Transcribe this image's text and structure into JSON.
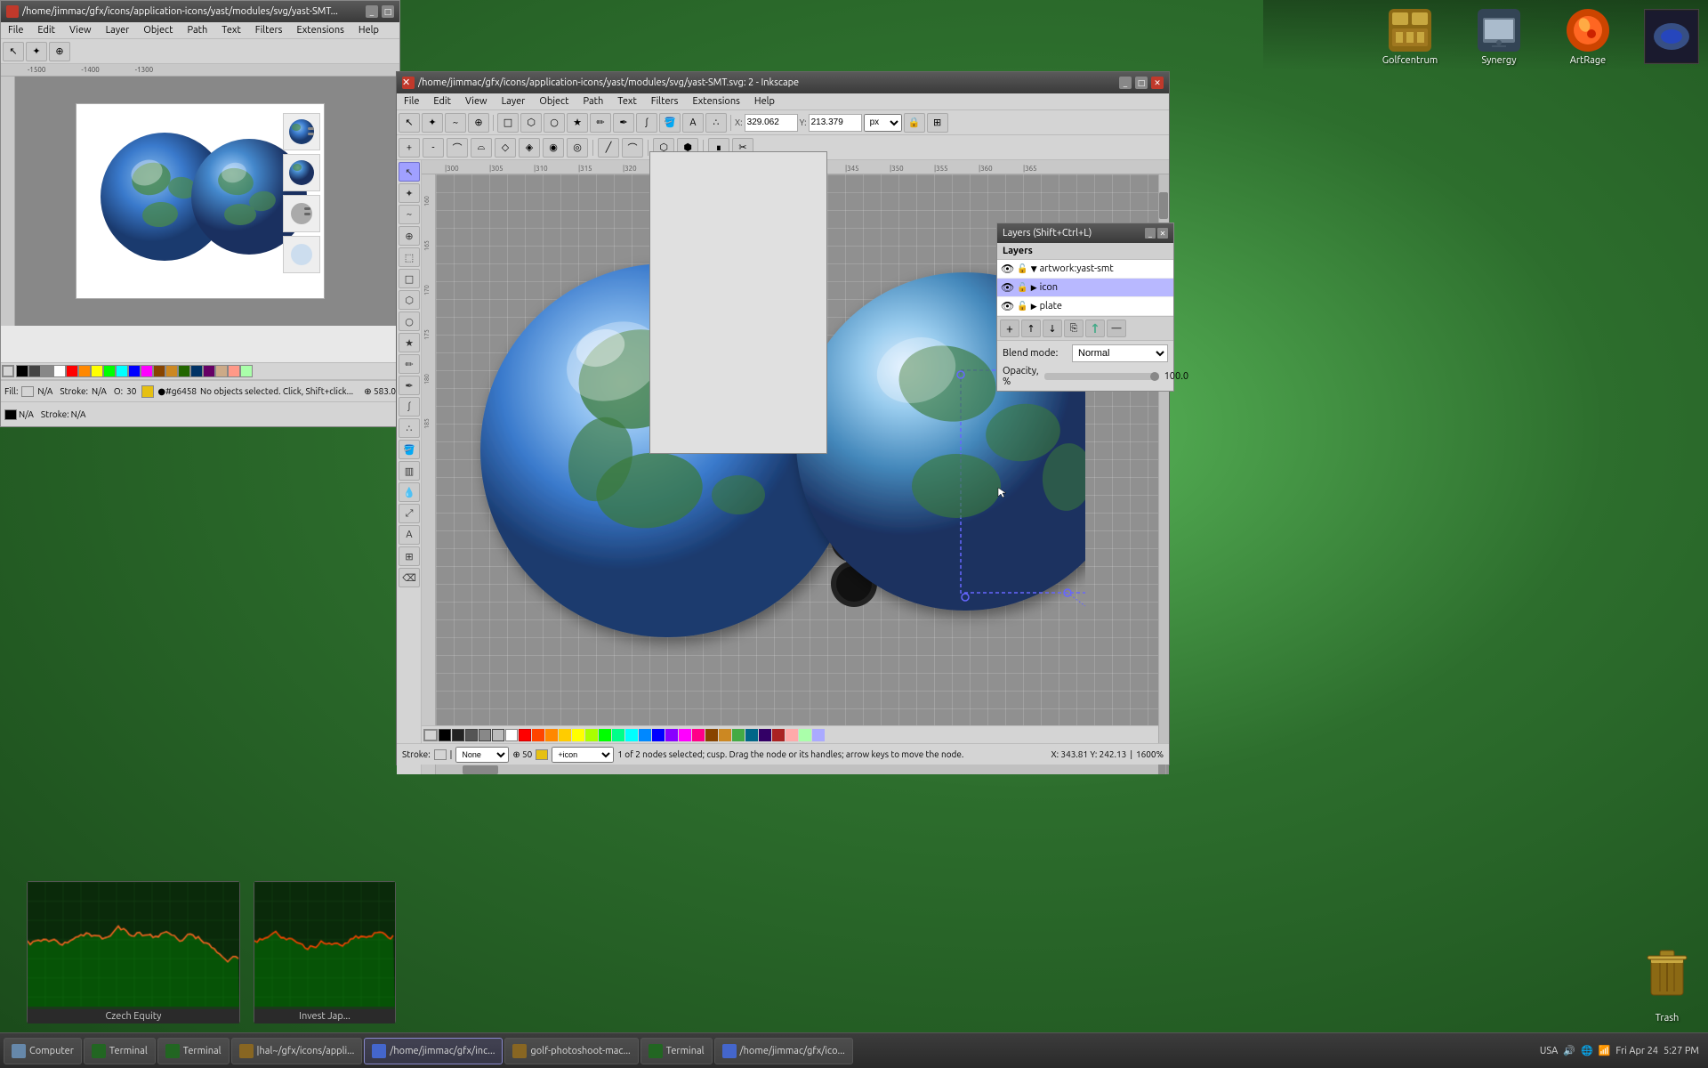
{
  "desktop": {
    "background": "green gradient"
  },
  "inkscape_small": {
    "title": "/home/jimmac/gfx/icons/application-icons/yast/modules/svg/yast-SMT...",
    "menu": [
      "File",
      "Edit",
      "View",
      "Layer",
      "Object",
      "Path",
      "Text",
      "Filters",
      "Extensions",
      "Help"
    ]
  },
  "inkscape_main": {
    "title": "/home/jimmac/gfx/icons/application-icons/yast/modules/svg/yast-SMT.svg: 2 - Inkscape",
    "menu": [
      "File",
      "Edit",
      "View",
      "Layer",
      "Object",
      "Path",
      "Text",
      "Filters",
      "Extensions",
      "Help"
    ],
    "coords": {
      "x_label": "X:",
      "x_value": "329.062",
      "y_label": "Y:",
      "y_value": "213.379",
      "unit": "px"
    },
    "statusbar": {
      "fill_label": "Fill:",
      "fill_value": "N/A",
      "stroke_label": "Stroke:",
      "stroke_value": "N/A",
      "opacity_label": "O:",
      "opacity_value": "30",
      "color_hex": "#g6458",
      "status_text": "No objects selected. Click, Shift+click...",
      "node_status": "1 of 2 nodes selected; cusp. Drag the node or its handles; arrow keys to move the node.",
      "zoom_level": "1600%",
      "coords_bottom": "X: 343.81  Y: 242.13"
    }
  },
  "layers_panel": {
    "title": "Layers (Shift+Ctrl+L)",
    "header": "Layers",
    "layers": [
      {
        "name": "artwork:yast-smt",
        "visible": true,
        "locked": false,
        "expanded": true
      },
      {
        "name": "icon",
        "visible": true,
        "locked": false,
        "expanded": false,
        "selected": true
      },
      {
        "name": "plate",
        "visible": true,
        "locked": false,
        "expanded": false
      }
    ],
    "blend_mode_label": "Blend mode:",
    "blend_mode_value": "Normal",
    "opacity_label": "Opacity, %",
    "opacity_value": "100.0"
  },
  "desktop_icons": [
    {
      "label": "Golfcentrum",
      "icon": "folder"
    },
    {
      "label": "Synergy",
      "icon": "app"
    },
    {
      "label": "ArtRage",
      "icon": "paint"
    }
  ],
  "trash": {
    "label": "Trash",
    "icon": "🗑"
  },
  "charts": [
    {
      "label": "Czech Equity"
    },
    {
      "label": "Invest Jap..."
    }
  ],
  "taskbar": {
    "items": [
      {
        "label": "Computer",
        "icon": "🖥"
      },
      {
        "label": "Terminal",
        "icon": "▣"
      },
      {
        "label": "Terminal",
        "icon": "▣"
      },
      {
        "label": "|hal~/gfx/icons/appli...",
        "icon": "📁"
      },
      {
        "label": "/home/jimmac/gfx/inc...",
        "icon": "🎨"
      },
      {
        "label": "golf-photoshoot-mac...",
        "icon": "📁"
      },
      {
        "label": "Terminal",
        "icon": "▣"
      },
      {
        "label": "/home/jimmac/gfx/ico...",
        "icon": "🎨"
      }
    ],
    "right": {
      "locale": "USA",
      "time": "5:27 PM",
      "date": "Fri Apr 24"
    }
  },
  "palette_colors": [
    "#ff0000",
    "#ff4400",
    "#ff8800",
    "#ffcc00",
    "#ffff00",
    "#88ff00",
    "#00ff00",
    "#00ff88",
    "#00ffff",
    "#0088ff",
    "#0000ff",
    "#8800ff",
    "#ff00ff",
    "#ff0088",
    "#ffffff",
    "#cccccc",
    "#888888",
    "#444444",
    "#000000",
    "#884400",
    "#ff6666",
    "#ffaa66",
    "#ffff66",
    "#aaffaa",
    "#66aaff"
  ]
}
